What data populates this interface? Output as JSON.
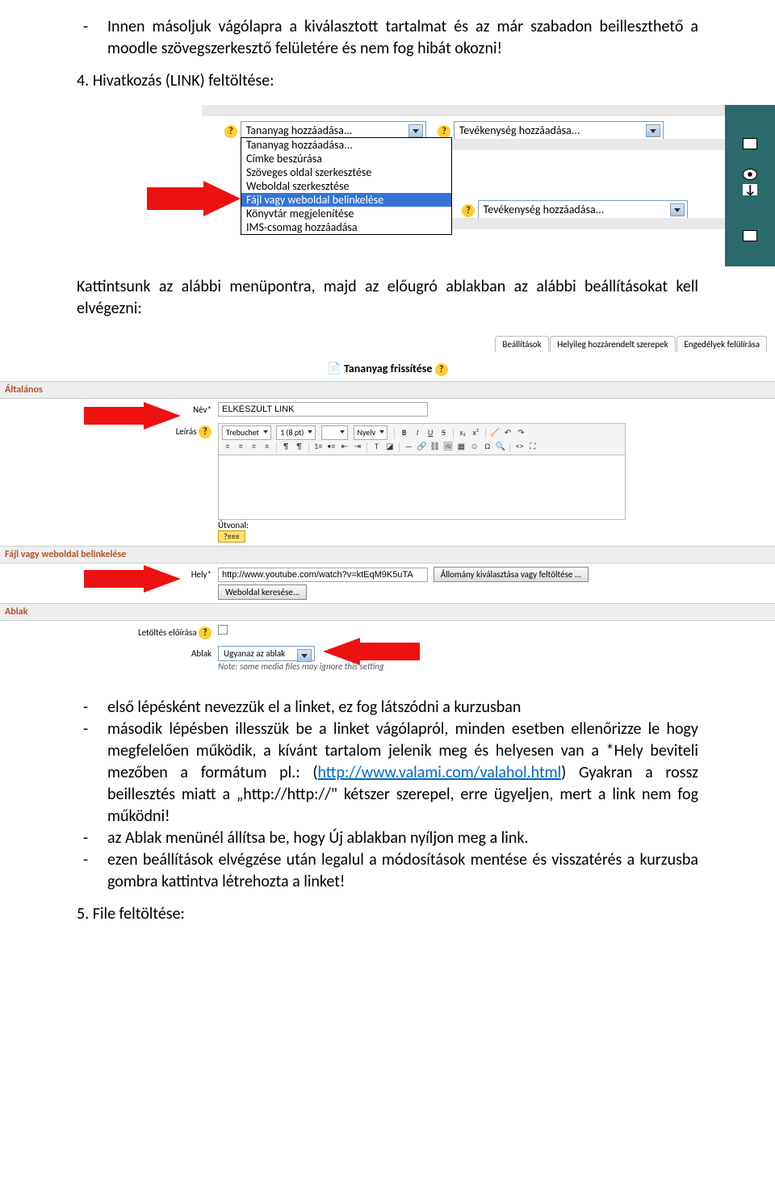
{
  "para1": "Innen másoljuk vágólapra a kiválasztott tartalmat és az már szabadon beilleszthető a moodle szövegszerkesztő felületére és nem fog hibát okozni!",
  "num4": "4. Hivatkozás (LINK) feltöltése:",
  "shot1": {
    "tananyag_label": "Tananyag hozzáadása...",
    "tevekenyseg_label": "Tevékenység hozzáadása...",
    "options": [
      "Tananyag hozzáadása...",
      "Címke beszúrása",
      "Szöveges oldal szerkesztése",
      "Weboldal szerkesztése",
      "Fájl vagy weboldal belinkelése",
      "Könyvtár megjelenítése",
      "IMS-csomag hozzáadása"
    ]
  },
  "para2": "Kattintsunk az alábbi menüpontra, majd az előugró ablakban az alábbi beállításokat kell elvégezni:",
  "form": {
    "tabs": {
      "t1": "Beállítások",
      "t2": "Helyileg hozzárendelt szerepek",
      "t3": "Engedélyek felülírása"
    },
    "title": "Tananyag frissítése",
    "sec_altalanos": "Általános",
    "nev_label": "Név*",
    "nev_value": "ELKÉSZÜLT LINK",
    "leiras_label": "Leírás",
    "font_family": "Trebuchet",
    "font_size": "1 (8 pt)",
    "lang": "Nyelv",
    "utvonal": "Útvonal:",
    "sec_fajl": "Fájl vagy weboldal belinkelése",
    "hely_label": "Hely*",
    "hely_value": "http://www.youtube.com/watch?v=ktEqM9K5uTA",
    "btn_allomany": "Állomány kiválasztása vagy feltöltése ...",
    "btn_weboldal": "Weboldal keresése...",
    "sec_ablak": "Ablak",
    "letoltes_label": "Letöltés előírása",
    "ablak_label": "Ablak",
    "ablak_value": "Ugyanaz az ablak",
    "note": "Note: some media files may ignore this setting"
  },
  "bullets": {
    "b1": "első lépésként nevezzük el a linket, ez fog látszódni a kurzusban",
    "b2a": "második lépésben illesszük be a linket vágólapról, minden esetben ellenőrizze le hogy megfelelően működik, a kívánt tartalom jelenik meg és helyesen van a *Hely beviteli mezőben a formátum pl.: (",
    "b2link": "http://www.valami.com/valahol.html",
    "b2b": ") Gyakran a rossz beillesztés miatt a „http://http://\" kétszer szerepel, erre ügyeljen, mert a link nem fog működni!",
    "b3": "az Ablak menünél állítsa be, hogy Új ablakban nyíljon meg a link.",
    "b4": "ezen beállítások elvégzése után legalul a módosítások mentése és visszatérés a kurzusba gombra kattintva létrehozta a linket!"
  },
  "num5": "5. File feltöltése:"
}
